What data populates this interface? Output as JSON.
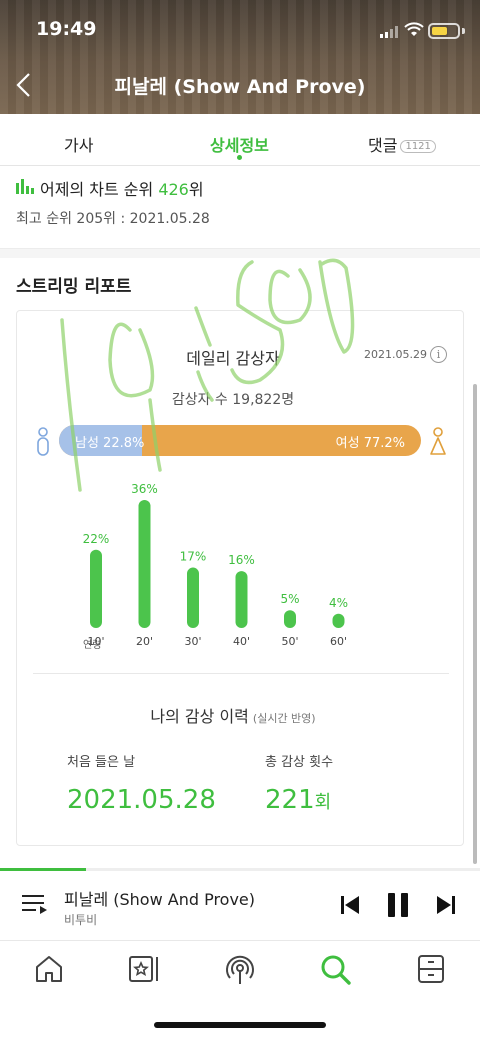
{
  "status_bar": {
    "time": "19:49"
  },
  "header": {
    "title": "피날레 (Show And Prove)"
  },
  "tabs": [
    {
      "label": "가사",
      "active": false
    },
    {
      "label": "상세정보",
      "active": true
    },
    {
      "label": "댓글",
      "badge": "1121",
      "active": false
    }
  ],
  "chart_rank": {
    "label_prefix": "어제의 차트 순위",
    "rank": "426",
    "rank_suffix": "위",
    "best": "최고 순위 205위 : 2021.05.28"
  },
  "streaming_report": {
    "title": "스트리밍 리포트",
    "daily_listeners": {
      "title": "데일리 감상자",
      "date": "2021.05.29",
      "info_icon": "i",
      "listener_count_text": "감상자 수 19,822명",
      "male_label": "남성 22.8%",
      "female_label": "여성 77.2%",
      "male_pct": 22.8,
      "female_pct": 77.2,
      "age_axis_label": "연령"
    },
    "history": {
      "title": "나의 감상 이력",
      "subtitle": "(실시간 반영)",
      "first_listen_label": "처음 들은 날",
      "first_listen_value": "2021.05.28",
      "total_count_label": "총 감상 횟수",
      "total_count_value": "221",
      "total_count_unit": "회"
    }
  },
  "chart_data": {
    "type": "bar",
    "categories": [
      "10'",
      "20'",
      "30'",
      "40'",
      "50'",
      "60'"
    ],
    "values": [
      22,
      36,
      17,
      16,
      5,
      4
    ],
    "value_labels": [
      "22%",
      "36%",
      "17%",
      "16%",
      "5%",
      "4%"
    ],
    "xlabel": "연령",
    "ylabel": "",
    "color": "#4cc44c"
  },
  "player": {
    "title": "피날레 (Show And Prove)",
    "artist": "비투비",
    "progress": 0.18
  },
  "colors": {
    "accent": "#3fbe3f",
    "male": "#a6c1e8",
    "female": "#e8a54b"
  },
  "nav": [
    "home-icon",
    "my-music-icon",
    "podcast-icon",
    "search-icon",
    "storage-icon"
  ]
}
